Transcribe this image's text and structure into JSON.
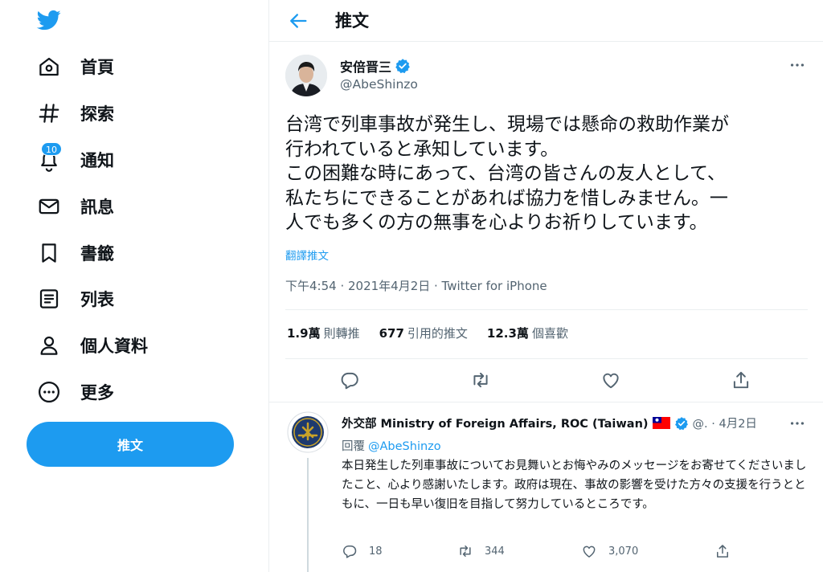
{
  "sidebar": {
    "items": [
      {
        "label": "首頁",
        "icon": "home-icon"
      },
      {
        "label": "探索",
        "icon": "hashtag-icon"
      },
      {
        "label": "通知",
        "icon": "bell-icon",
        "badge": "10"
      },
      {
        "label": "訊息",
        "icon": "mail-icon"
      },
      {
        "label": "書籤",
        "icon": "bookmark-icon"
      },
      {
        "label": "列表",
        "icon": "list-icon"
      },
      {
        "label": "個人資料",
        "icon": "profile-icon"
      },
      {
        "label": "更多",
        "icon": "more-circle-icon"
      }
    ],
    "tweet_button": "推文"
  },
  "header": {
    "title": "推文"
  },
  "tweet": {
    "author_name": "安倍晋三",
    "author_handle": "@AbeShinzo",
    "text": "台湾で列車事故が発生し、現場では懸命の救助作業が\n行われていると承知しています。\nこの困難な時にあって、台湾の皆さんの友人として、\n私たちにできることがあれば協力を惜しみません。一\n人でも多くの方の無事を心よりお祈りしています。",
    "translate": "翻譯推文",
    "meta": "下午4:54 · 2021年4月2日 · Twitter for iPhone",
    "stats": {
      "retweets": "1.9萬",
      "retweets_label": "則轉推",
      "quotes": "677",
      "quotes_label": "引用的推文",
      "likes": "12.3萬",
      "likes_label": "個喜歡"
    }
  },
  "reply": {
    "author_name": "外交部 Ministry of Foreign Affairs, ROC (Taiwan)",
    "handle_date": "@. · 4月2日",
    "replying_label": "回覆",
    "replying_to": "@AbeShinzo",
    "text": "本日発生した列車事故についてお見舞いとお悔やみのメッセージをお寄せてくださいましたこと、心より感謝いたします。政府は現在、事故の影響を受けた方々の支援を行うとともに、一日も早い復旧を目指して努力しているところです。",
    "replies": "18",
    "retweets": "344",
    "likes": "3,070"
  },
  "colors": {
    "accent": "#1d9bf0",
    "text": "#0f1419",
    "secondary": "#536471",
    "border": "#ebeef0"
  }
}
